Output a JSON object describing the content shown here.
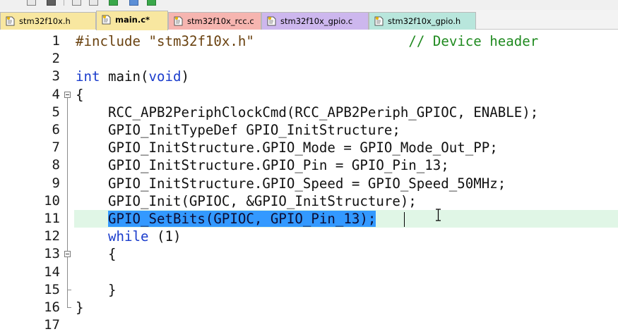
{
  "tabs": [
    {
      "label": "stm32f10x.h",
      "color": "#f8e7a0",
      "active": false
    },
    {
      "label": "main.c*",
      "color": "#f8e7a0",
      "active": true
    },
    {
      "label": "stm32f10x_rcc.c",
      "color": "#f6b5b0",
      "active": false
    },
    {
      "label": "stm32f10x_gpio.c",
      "color": "#cdb7ee",
      "active": false
    },
    {
      "label": "stm32f10x_gpio.h",
      "color": "#b8e6dc",
      "active": false
    }
  ],
  "editor": {
    "line_numbers": [
      "1",
      "2",
      "3",
      "4",
      "5",
      "6",
      "7",
      "8",
      "9",
      "10",
      "11",
      "12",
      "13",
      "14",
      "15",
      "16",
      "17"
    ],
    "lines": [
      [
        [
          "pp",
          "#include "
        ],
        [
          "str",
          "\"stm32f10x.h\""
        ],
        [
          "",
          "                   "
        ],
        [
          "cm",
          "// Device header"
        ]
      ],
      [],
      [
        [
          "kw",
          "int"
        ],
        [
          "",
          " main("
        ],
        [
          "kw",
          "void"
        ],
        [
          "",
          ")"
        ]
      ],
      [
        [
          "",
          "{"
        ]
      ],
      [
        [
          "",
          "    RCC_APB2PeriphClockCmd(RCC_APB2Periph_GPIOC, ENABLE);"
        ]
      ],
      [
        [
          "",
          "    GPIO_InitTypeDef GPIO_InitStructure;"
        ]
      ],
      [
        [
          "",
          "    GPIO_InitStructure.GPIO_Mode = GPIO_Mode_Out_PP;"
        ]
      ],
      [
        [
          "",
          "    GPIO_InitStructure.GPIO_Pin = GPIO_Pin_13;"
        ]
      ],
      [
        [
          "",
          "    GPIO_InitStructure.GPIO_Speed = GPIO_Speed_50MHz;"
        ]
      ],
      [
        [
          "",
          "    GPIO_Init(GPIOC, &GPIO_InitStructure);"
        ]
      ],
      [
        [
          "",
          "    "
        ],
        [
          "sel",
          "GPIO_SetBits(GPIOC, GPIO_Pin_13);"
        ]
      ],
      [
        [
          "",
          "    "
        ],
        [
          "kw",
          "while"
        ],
        [
          "",
          " (1)"
        ]
      ],
      [
        [
          "",
          "    {"
        ]
      ],
      [],
      [
        [
          "",
          "    }"
        ]
      ],
      [
        [
          "",
          "}"
        ]
      ],
      []
    ],
    "current_line": 11
  }
}
